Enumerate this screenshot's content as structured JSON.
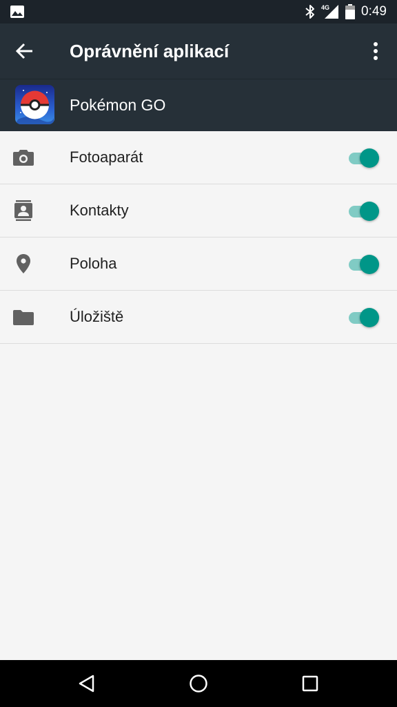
{
  "status_bar": {
    "time": "0:49",
    "network": "4G",
    "icons": [
      "image-notification-icon",
      "bluetooth-icon",
      "signal-icon",
      "battery-icon"
    ]
  },
  "app_bar": {
    "title": "Oprávnění aplikací",
    "back_icon": "arrow-back-icon",
    "menu_icon": "more-vert-icon"
  },
  "app_header": {
    "name": "Pokémon GO",
    "icon": "pokeball-icon"
  },
  "permissions": [
    {
      "label": "Fotoaparát",
      "icon": "camera-icon",
      "enabled": true
    },
    {
      "label": "Kontakty",
      "icon": "contacts-icon",
      "enabled": true
    },
    {
      "label": "Poloha",
      "icon": "location-icon",
      "enabled": true
    },
    {
      "label": "Úložiště",
      "icon": "folder-icon",
      "enabled": true
    }
  ],
  "nav_bar": {
    "icons": [
      "nav-back-icon",
      "nav-home-icon",
      "nav-recents-icon"
    ]
  },
  "colors": {
    "status_bar": "#1c232a",
    "app_bar": "#263038",
    "background": "#f5f5f5",
    "toggle_thumb": "#009688",
    "toggle_track": "#80cbc4",
    "icon_gray": "#616161"
  }
}
